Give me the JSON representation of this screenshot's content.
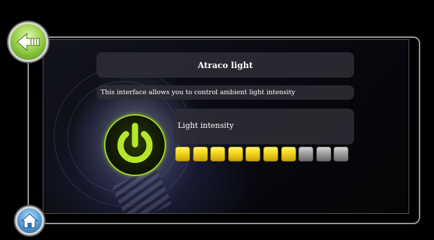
{
  "header": {
    "title": "Atraco light"
  },
  "description": {
    "text": "This interface allows you to control ambient light intensity"
  },
  "intensity": {
    "label": "Light intensity",
    "level": 7,
    "max": 10
  },
  "controls": {
    "back_icon": "back-arrow-icon",
    "home_icon": "home-icon",
    "power_icon": "power-icon"
  },
  "colors": {
    "accent_green": "#9fd61e",
    "bar_on": "#f2d61c",
    "bar_off": "#9a9a9a"
  }
}
